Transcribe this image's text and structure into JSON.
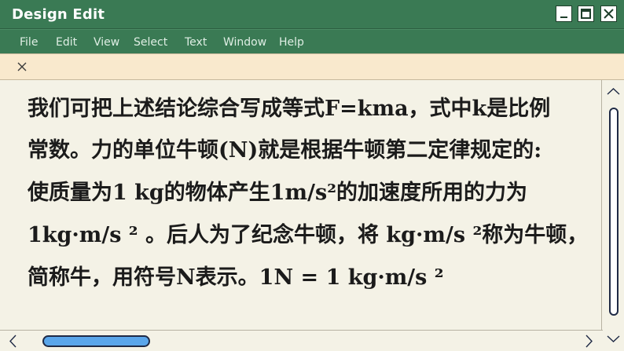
{
  "window": {
    "title": "Design Edit"
  },
  "menu": [
    "File",
    "Edit",
    "View",
    "Select",
    "Text",
    "Window",
    "Help"
  ],
  "document": {
    "lines": [
      "我们可把上述结论综合写成等式F=kma，式中k是比例",
      "常数。力的单位牛顿(N)就是根据牛顿第二定律规定的:",
      "使质量为1 kg的物体产生1m/s²的加速度所用的力为",
      "1kg·m/s ² 。后人为了纪念牛顿，将 kg·m/s ²称为牛顿，",
      "简称牛，用符号N表示。1N = 1 kg·m/s ²"
    ]
  },
  "scrollbars": {
    "vertical_position": 0.0,
    "horizontal_position": 0.0
  },
  "colors": {
    "titlebar": "#3a7a54",
    "tabstrip": "#f9e9cd",
    "editor_bg": "#f4f2e6",
    "text": "#1b1b1b",
    "hscroll_thumb": "#5aa6ea"
  },
  "icons": {
    "minimize": "minimize-icon",
    "maximize": "maximize-icon",
    "close": "close-icon",
    "tab_close": "close-tab-icon"
  }
}
